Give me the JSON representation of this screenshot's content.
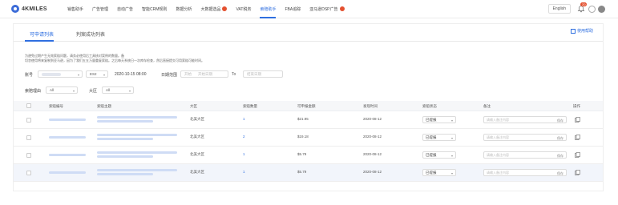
{
  "brand": {
    "logo_text": "4KMILES"
  },
  "nav": {
    "items": [
      {
        "label": "销售助手",
        "badge": false,
        "active": false
      },
      {
        "label": "广告管理",
        "badge": false,
        "active": false
      },
      {
        "label": "自动广告",
        "badge": false,
        "active": false
      },
      {
        "label": "智能CRM规则",
        "badge": false,
        "active": false
      },
      {
        "label": "数据分析",
        "badge": false,
        "active": false
      },
      {
        "label": "大数据选品",
        "badge": true,
        "active": false
      },
      {
        "label": "VAT税务",
        "badge": false,
        "active": false
      },
      {
        "label": "索赔助手",
        "badge": false,
        "active": true
      },
      {
        "label": "FBA追踪",
        "badge": false,
        "active": false
      },
      {
        "label": "亚马逊DSP广告",
        "badge": true,
        "active": false
      }
    ],
    "language": "English",
    "notification_count": "20"
  },
  "tabs": [
    {
      "label": "可申请列表",
      "active": true
    },
    {
      "label": "判案成功列表",
      "active": false
    }
  ],
  "help": {
    "label": "使用帮助"
  },
  "notice": {
    "line1": "为避免过期产生无效索赔问题，请务必使用后工具核对案例的数量。备",
    "line2": "切忽使用将来复制到亚马逊，因为了我们五五万量重复索赔。之后每天系统日一次库存检查，然后直接提交可用索赔可能时间。"
  },
  "filters": {
    "account_label": "账号",
    "account_value": "",
    "site_value": "ES2",
    "date_value": "2020-10-15 08:00",
    "date_range_label": "日期范围",
    "date_prefix": "开始",
    "start_placeholder": "开始日期",
    "to_label": "To",
    "end_placeholder": "结束日期",
    "reason_label": "索赔理由",
    "reason_value": "All",
    "big_label": "大区",
    "big_value": "All"
  },
  "table": {
    "headers": [
      "索赔编号",
      "索赔主题",
      "大区",
      "索赔数量",
      "可申报金额",
      "发现时间",
      "索赔状态",
      "备注",
      "操作"
    ],
    "rows": [
      {
        "region": "北美大区",
        "qty": "1",
        "amount": "$21.95",
        "date": "2020-08-12",
        "status": "已提报",
        "remark_placeholder": "请输入备注内容",
        "save": "保存"
      },
      {
        "region": "北美大区",
        "qty": "2",
        "amount": "$19.18",
        "date": "2020-08-12",
        "status": "已提报",
        "remark_placeholder": "请输入备注内容",
        "save": "保存"
      },
      {
        "region": "北美大区",
        "qty": "1",
        "amount": "$5.79",
        "date": "2020-08-12",
        "status": "已提报",
        "remark_placeholder": "请输入备注内容",
        "save": "保存"
      },
      {
        "region": "北美大区",
        "qty": "1",
        "amount": "$5.79",
        "date": "2020-08-12",
        "status": "已提报",
        "remark_placeholder": "请输入备注内容",
        "save": "保存"
      }
    ]
  },
  "colors": {
    "accent": "#2f6fe0",
    "badge": "#e4502f"
  }
}
